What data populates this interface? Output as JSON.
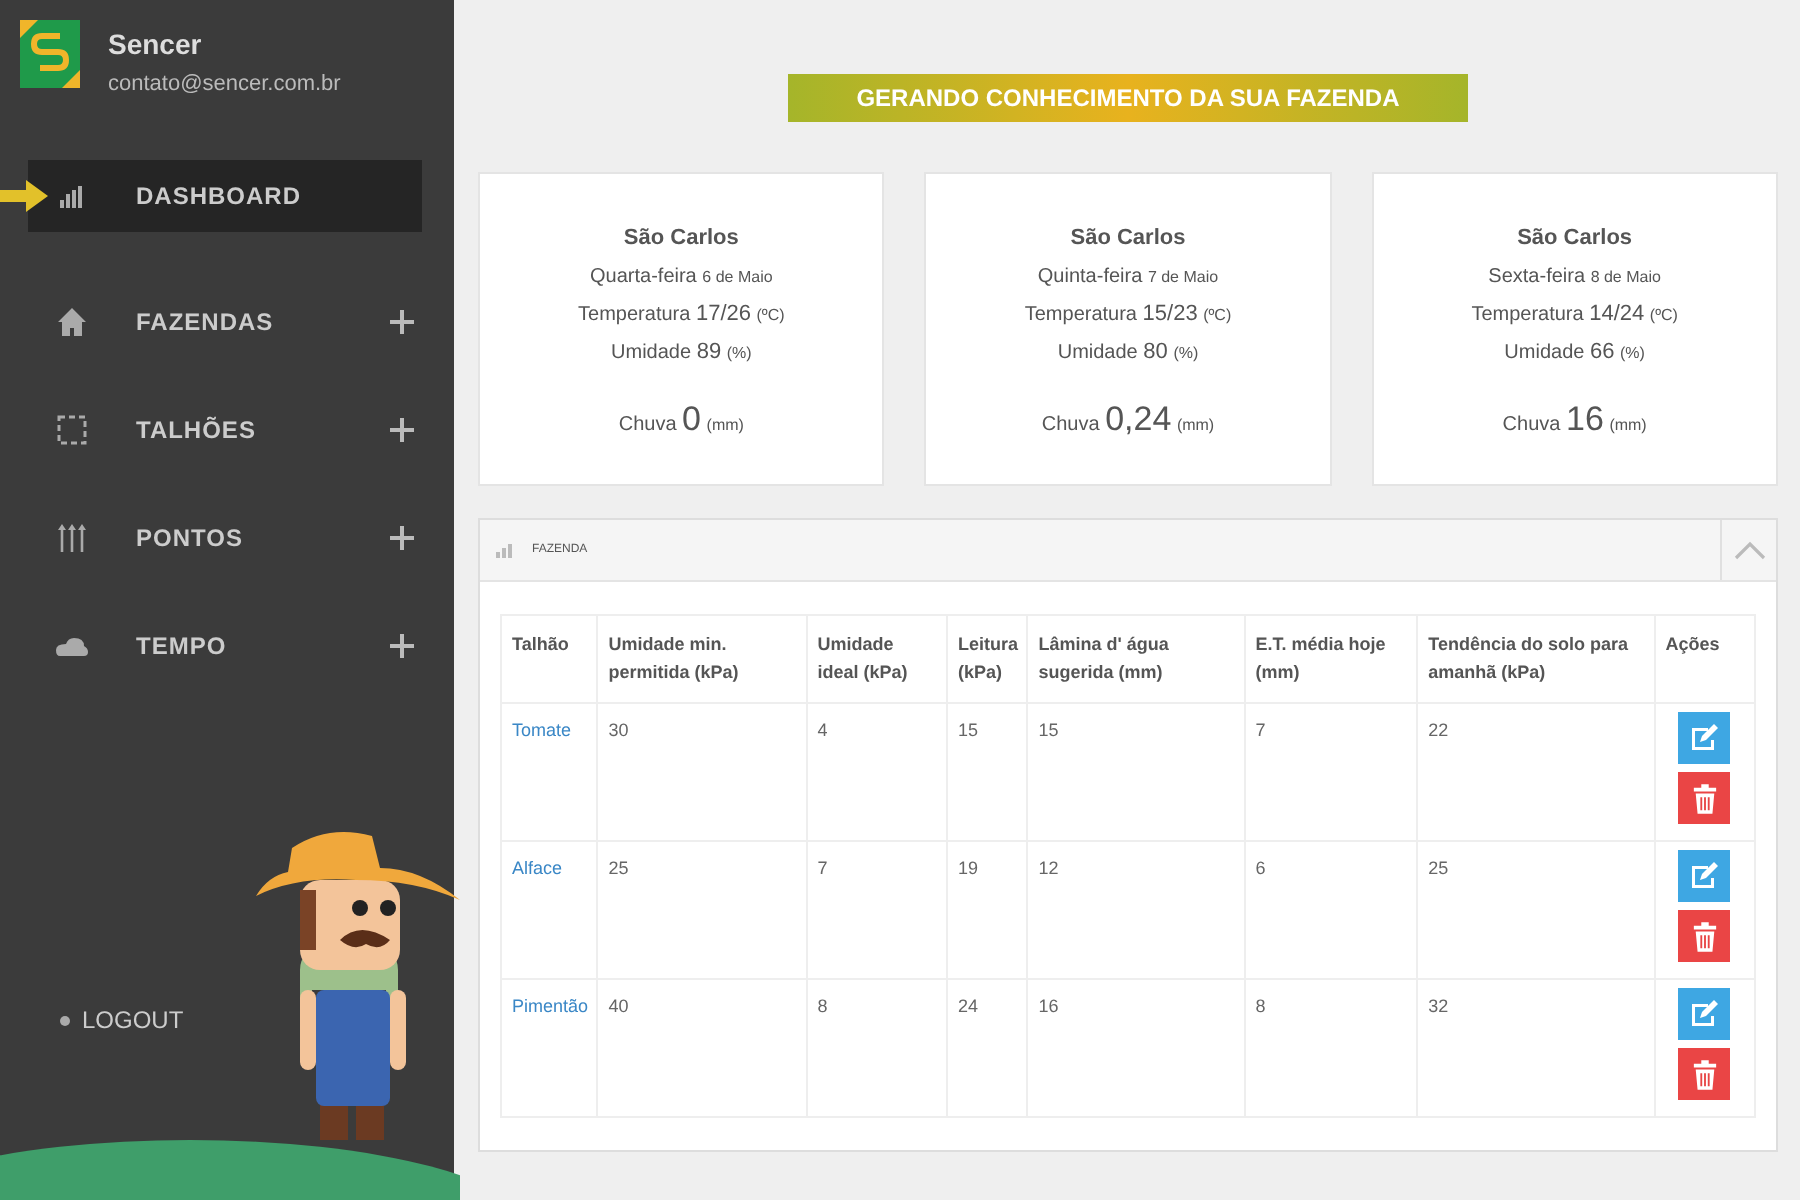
{
  "sidebar": {
    "brand": "Sencer",
    "email": "contato@sencer.com.br",
    "items": [
      {
        "label": "DASHBOARD",
        "selected": true,
        "expandable": false
      },
      {
        "label": "FAZENDAS",
        "selected": false,
        "expandable": true
      },
      {
        "label": "TALHÕES",
        "selected": false,
        "expandable": true
      },
      {
        "label": "PONTOS",
        "selected": false,
        "expandable": true
      },
      {
        "label": "TEMPO",
        "selected": false,
        "expandable": true
      }
    ],
    "logout": "LOGOUT"
  },
  "banner": "GERANDO CONHECIMENTO DA SUA FAZENDA",
  "weather": [
    {
      "city": "São Carlos",
      "weekday": "Quarta-feira",
      "date": "6 de Maio",
      "temp_label": "Temperatura",
      "temp": "17/26",
      "temp_unit": "(ºC)",
      "humidity_label": "Umidade",
      "humidity": "89",
      "humidity_unit": "(%)",
      "rain_label": "Chuva",
      "rain": "0",
      "rain_unit": "(mm)"
    },
    {
      "city": "São Carlos",
      "weekday": "Quinta-feira",
      "date": "7 de Maio",
      "temp_label": "Temperatura",
      "temp": "15/23",
      "temp_unit": "(ºC)",
      "humidity_label": "Umidade",
      "humidity": "80",
      "humidity_unit": "(%)",
      "rain_label": "Chuva",
      "rain": "0,24",
      "rain_unit": "(mm)"
    },
    {
      "city": "São Carlos",
      "weekday": "Sexta-feira",
      "date": "8 de Maio",
      "temp_label": "Temperatura",
      "temp": "14/24",
      "temp_unit": "(ºC)",
      "humidity_label": "Umidade",
      "humidity": "66",
      "humidity_unit": "(%)",
      "rain_label": "Chuva",
      "rain": "16",
      "rain_unit": "(mm)"
    }
  ],
  "panel": {
    "title": "FAZENDA",
    "columns": [
      "Talhão",
      "Umidade min. permitida (kPa)",
      "Umidade ideal (kPa)",
      "Leitura (kPa)",
      "Lâmina d' água sugerida (mm)",
      "E.T. média hoje (mm)",
      "Tendência do solo para amanhã (kPa)",
      "Ações"
    ],
    "rows": [
      {
        "talhao": "Tomate",
        "values": [
          "30",
          "4",
          "15",
          "15",
          "7",
          "22"
        ]
      },
      {
        "talhao": "Alface",
        "values": [
          "25",
          "7",
          "19",
          "12",
          "6",
          "25"
        ]
      },
      {
        "talhao": "Pimentão",
        "values": [
          "40",
          "8",
          "24",
          "16",
          "8",
          "32"
        ]
      }
    ]
  }
}
